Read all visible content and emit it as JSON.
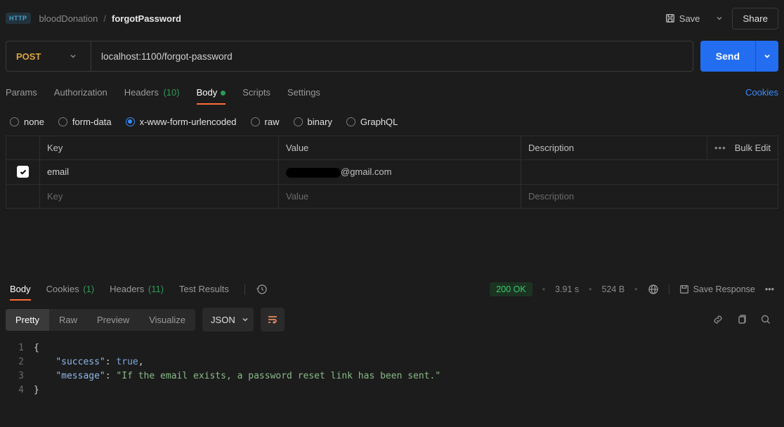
{
  "header": {
    "http_badge": "HTTP",
    "crumb_collection": "bloodDonation",
    "crumb_request": "forgotPassword",
    "save_label": "Save",
    "share_label": "Share"
  },
  "request": {
    "method": "POST",
    "url": "localhost:1100/forgot-password"
  },
  "send": {
    "label": "Send"
  },
  "tabs": {
    "params": "Params",
    "authorization": "Authorization",
    "headers": "Headers",
    "headers_count": "(10)",
    "body": "Body",
    "scripts": "Scripts",
    "settings": "Settings",
    "cookies_link": "Cookies"
  },
  "body_types": {
    "none": "none",
    "form_data": "form-data",
    "urlencoded": "x-www-form-urlencoded",
    "raw": "raw",
    "binary": "binary",
    "graphql": "GraphQL"
  },
  "kv": {
    "head_key": "Key",
    "head_value": "Value",
    "head_desc": "Description",
    "bulk_edit": "Bulk Edit",
    "row1_key": "email",
    "row1_value_suffix": "@gmail.com",
    "placeholder_key": "Key",
    "placeholder_value": "Value",
    "placeholder_desc": "Description"
  },
  "response": {
    "tabs": {
      "body": "Body",
      "cookies": "Cookies",
      "cookies_count": "(1)",
      "headers": "Headers",
      "headers_count": "(11)",
      "test_results": "Test Results"
    },
    "status": "200 OK",
    "time": "3.91 s",
    "size": "524 B",
    "save_response": "Save Response",
    "views": {
      "pretty": "Pretty",
      "raw": "Raw",
      "preview": "Preview",
      "visualize": "Visualize"
    },
    "format": "JSON",
    "code": {
      "l1": "{",
      "l2_key": "\"success\"",
      "l2_val": "true",
      "l3_key": "\"message\"",
      "l3_val": "\"If the email exists, a password reset link has been sent.\"",
      "l4": "}",
      "n1": "1",
      "n2": "2",
      "n3": "3",
      "n4": "4"
    }
  }
}
